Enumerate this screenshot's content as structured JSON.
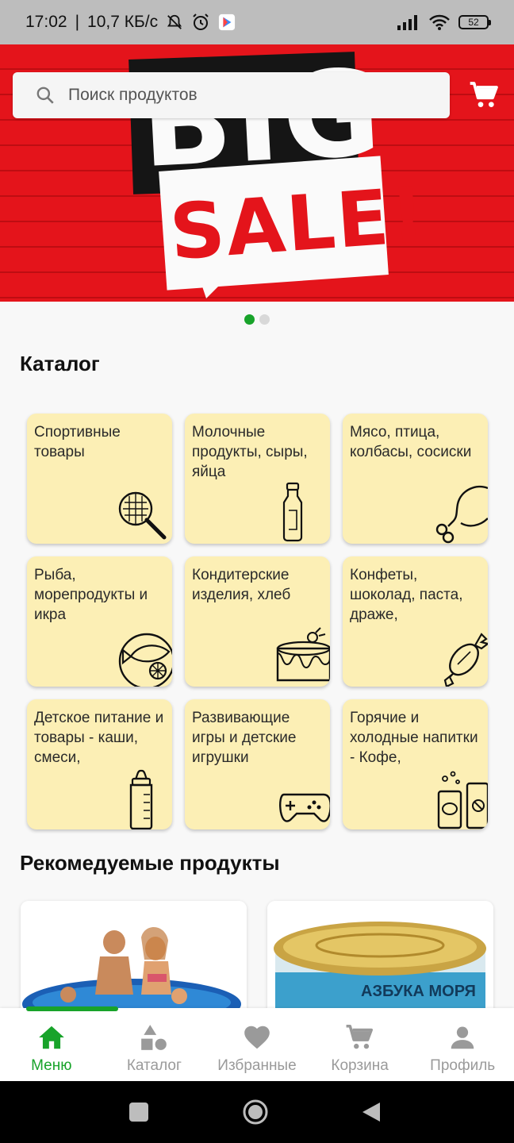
{
  "status_bar": {
    "time": "17:02",
    "speed": "10,7 КБ/с",
    "battery": "52"
  },
  "search": {
    "placeholder": "Поиск продуктов"
  },
  "banner": {
    "line1": "BIG",
    "line2": "SALE!",
    "slides": 2,
    "active_slide": 1
  },
  "catalog": {
    "title": "Каталог",
    "items": [
      {
        "label": "Спортивные товары",
        "icon": "tennis-racket-icon"
      },
      {
        "label": "Молочные продукты, сыры, яйца",
        "icon": "milk-bottle-icon"
      },
      {
        "label": "Мясо, птица, колбасы, сосиски",
        "icon": "chicken-leg-icon"
      },
      {
        "label": "Рыба, морепродукты и икра",
        "icon": "fish-plate-icon"
      },
      {
        "label": "Кондитерские изделия, хлеб",
        "icon": "cake-icon"
      },
      {
        "label": "Конфеты, шоколад, паста, драже,",
        "icon": "candy-icon"
      },
      {
        "label": "Детское питание и товары - каши, смеси,",
        "icon": "baby-bottle-icon"
      },
      {
        "label": "Развивающие игры и детские игрушки",
        "icon": "gamepad-icon"
      },
      {
        "label": "Горячие и холодные напитки - Кофе,",
        "icon": "drinks-icon"
      }
    ]
  },
  "recommended": {
    "title": "Рекомедуемые продукты",
    "products": [
      {
        "image": "inflatable-pool-image"
      },
      {
        "image": "canned-fish-image",
        "brand_text": "АЗБУКА МОРЯ"
      }
    ]
  },
  "bottom_nav": {
    "items": [
      {
        "label": "Меню",
        "icon": "home-icon",
        "active": true
      },
      {
        "label": "Каталог",
        "icon": "shapes-icon",
        "active": false
      },
      {
        "label": "Избранные",
        "icon": "heart-icon",
        "active": false
      },
      {
        "label": "Корзина",
        "icon": "cart-icon",
        "active": false
      },
      {
        "label": "Профиль",
        "icon": "person-icon",
        "active": false
      }
    ]
  },
  "colors": {
    "accent": "#18a32a",
    "banner_red": "#e4141b",
    "card_bg": "#fcefb5"
  }
}
